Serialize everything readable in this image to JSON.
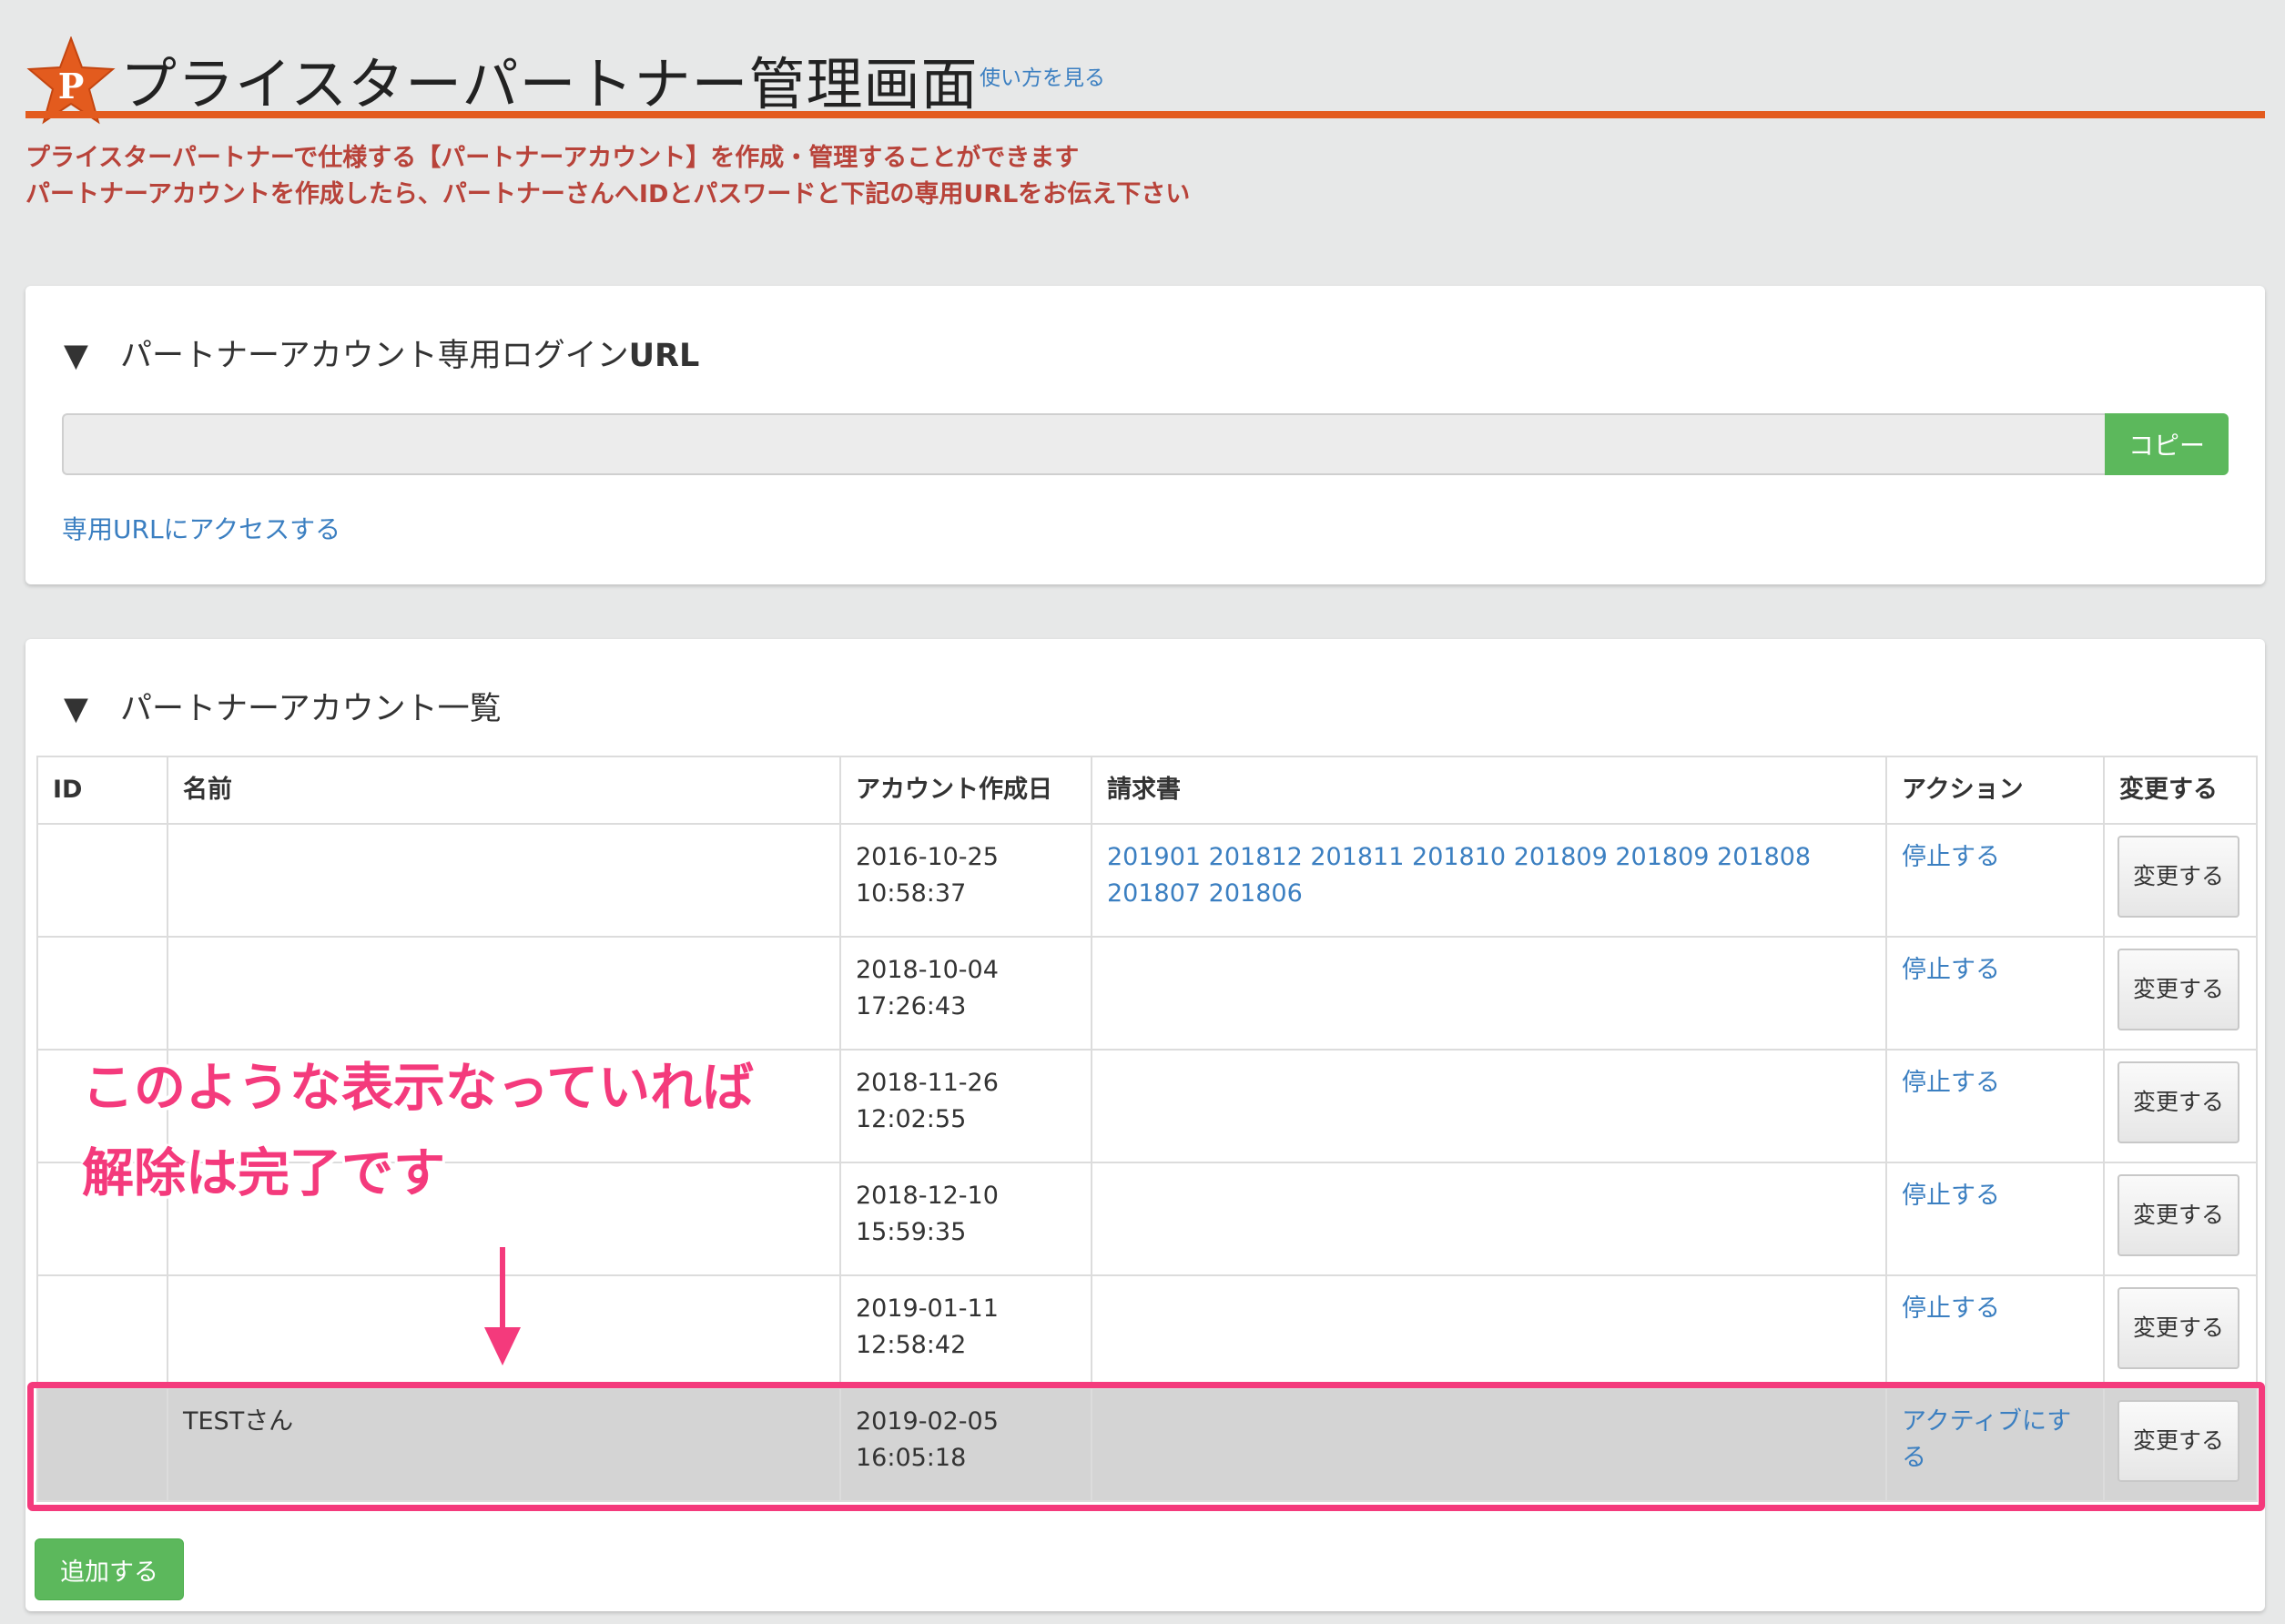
{
  "header": {
    "title": "プライスターパートナー管理画面",
    "howto_link": "使い方を見る",
    "logo_letter": "P"
  },
  "intro": {
    "line1": "プライスターパートナーで仕様する【パートナーアカウント】を作成・管理することができます",
    "line2": "パートナーアカウントを作成したら、パートナーさんへIDとパスワードと下記の専用URLをお伝え下さい"
  },
  "url_panel": {
    "triangle": "▼",
    "heading_prefix": "パートナーアカウント専用ログイン",
    "heading_suffix": "URL",
    "input_value": "",
    "copy_label": "コピー",
    "access_link": "専用URLにアクセスする"
  },
  "list_panel": {
    "triangle": "▼",
    "heading": "パートナーアカウント一覧",
    "columns": [
      "ID",
      "名前",
      "アカウント作成日",
      "請求書",
      "アクション",
      "変更する"
    ],
    "rows": [
      {
        "id": "",
        "name": "",
        "date": "2016-10-25",
        "time": "10:58:37",
        "invoices": [
          "201901",
          "201812",
          "201811",
          "201810",
          "201809",
          "201809",
          "201808",
          "201807",
          "201806"
        ],
        "action": "停止する",
        "change": "変更する"
      },
      {
        "id": "",
        "name": "",
        "date": "2018-10-04",
        "time": "17:26:43",
        "invoices": [],
        "action": "停止する",
        "change": "変更する"
      },
      {
        "id": "",
        "name": "",
        "date": "2018-11-26",
        "time": "12:02:55",
        "invoices": [],
        "action": "停止する",
        "change": "変更する"
      },
      {
        "id": "",
        "name": "",
        "date": "2018-12-10",
        "time": "15:59:35",
        "invoices": [],
        "action": "停止する",
        "change": "変更する"
      },
      {
        "id": "",
        "name": "",
        "date": "2019-01-11",
        "time": "12:58:42",
        "invoices": [],
        "action": "停止する",
        "change": "変更する"
      },
      {
        "id": "",
        "name": "TESTさん",
        "date": "2019-02-05",
        "time": "16:05:18",
        "invoices": [],
        "action": "アクティブにする",
        "change": "変更する"
      }
    ],
    "add_label": "追加する"
  },
  "annotation": {
    "line1": "このような表示なっていれば",
    "line2": "解除は完了です",
    "color": "#f43a7c"
  },
  "colors": {
    "accent_orange": "#e35b1e",
    "link_blue": "#3b7fc1",
    "green_button": "#5cb85c",
    "intro_red": "#b8433a"
  }
}
